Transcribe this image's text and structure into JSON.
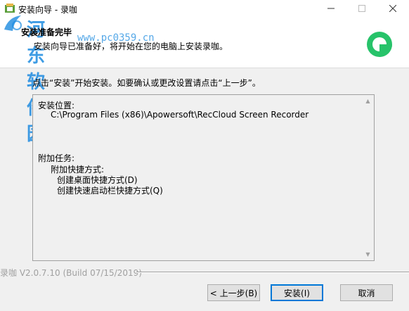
{
  "window": {
    "title": "安装向导 - 录咖"
  },
  "watermark": {
    "text": "河东软件园",
    "url": "www.pc0359.cn"
  },
  "header": {
    "title": "安装准备完毕",
    "subtitle": "安装向导已准备好，将开始在您的电脑上安装录咖。"
  },
  "instruction": "点击“安装”开始安装。如要确认或更改设置请点击“上一步”。",
  "summary": {
    "location_label": "安装位置:",
    "location_value": "C:\\Program Files (x86)\\Apowersoft\\RecCloud Screen Recorder",
    "tasks_label": "附加任务:",
    "shortcut_label": "附加快捷方式:",
    "task_desktop": "创建桌面快捷方式(D)",
    "task_quicklaunch": "创建快速启动栏快捷方式(Q)"
  },
  "version": "录咖 V2.0.7.10  (Build 07/15/2019)",
  "buttons": {
    "back": "< 上一步(B)",
    "install": "安装(I)",
    "cancel": "取消"
  },
  "colors": {
    "watermark": "#1d8be0",
    "logo": "#27c36a",
    "focus": "#0078d7"
  }
}
